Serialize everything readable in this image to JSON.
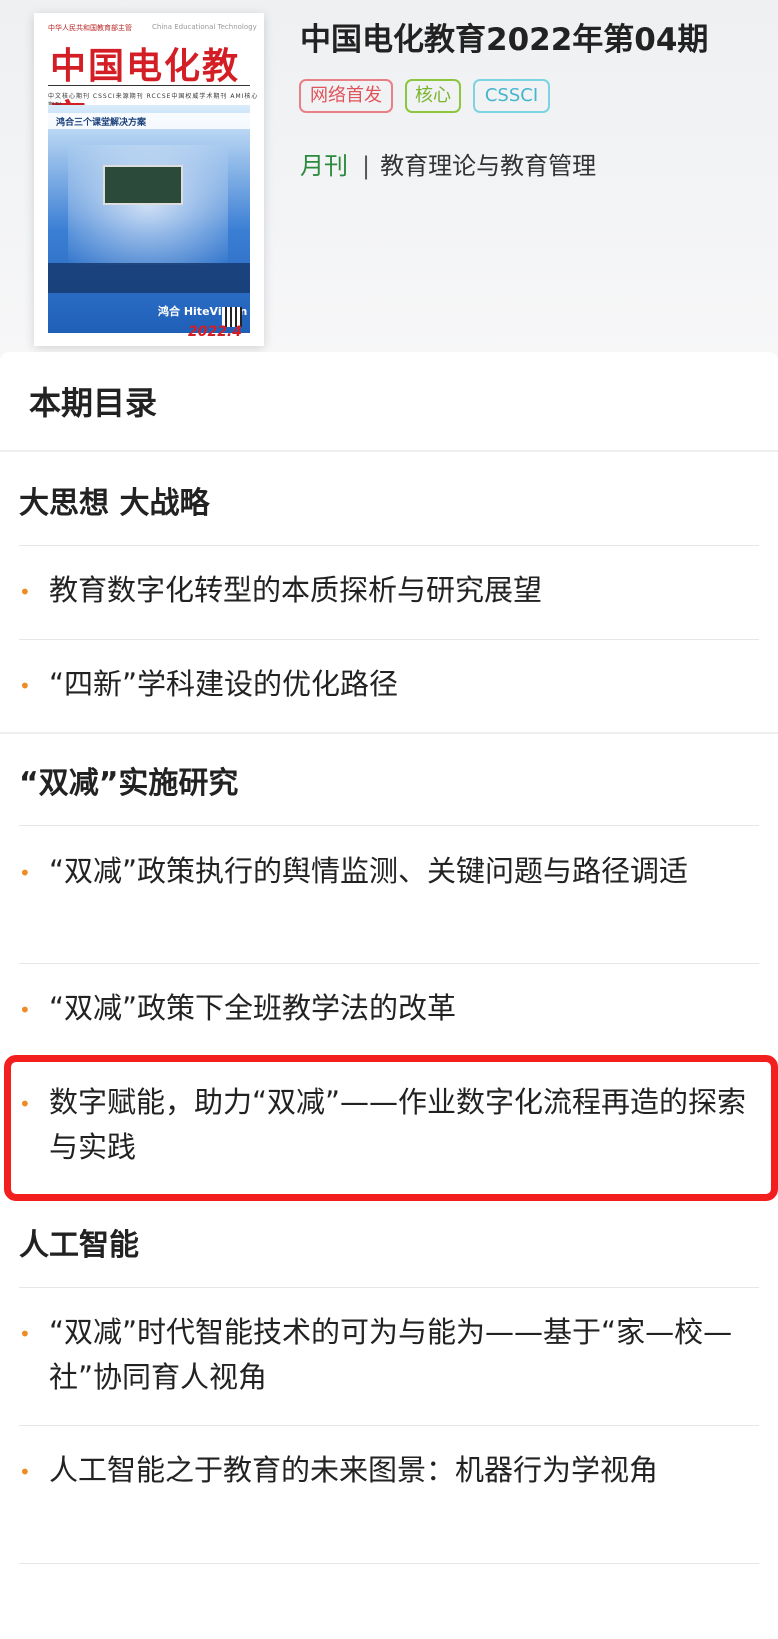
{
  "journal": {
    "title": "中国电化教育2022年第04期",
    "badges": [
      "网络首发",
      "核心",
      "CSSCI"
    ],
    "frequency": "月刊",
    "separator": "|",
    "subject": "教育理论与教育管理",
    "cover": {
      "logo": "中国电化教育",
      "sponsor_line": "中华人民共和国教育部主管",
      "english": "China Educational Technology",
      "tags": "中文核心期刊  CSSCI来源期刊  RCCSE中国权威学术期刊  AMI核心期刊",
      "feature": "鸿合三个课堂解决方案",
      "brand": "鸿合 HiteVision",
      "issue": "2022.4"
    },
    "colors": {
      "badge_network": "#e0555b",
      "badge_core": "#7bb52e",
      "badge_cssci": "#43b6cc",
      "frequency": "#2b8a3e",
      "bullet": "#f08a24",
      "highlight": "#f31e1e"
    }
  },
  "toc": {
    "heading": "本期目录",
    "sections": [
      {
        "title": "大思想 大战略",
        "articles": [
          "教育数字化转型的本质探析与研究展望",
          "“四新”学科建设的优化路径"
        ]
      },
      {
        "title": "“双减”实施研究",
        "articles": [
          "“双减”政策执行的舆情监测、关键问题与路径调适",
          "“双减”政策下全班教学法的改革",
          "数字赋能，助力“双减”——作业数字化流程再造的探索与实践"
        ]
      },
      {
        "title": "人工智能",
        "articles": [
          "“双减”时代智能技术的可为与能为——基于“家—校—社”协同育人视角",
          "人工智能之于教育的未来图景：机器行为学视角"
        ]
      }
    ],
    "bullet": "•",
    "highlighted_article": "数字赋能，助力“双减”——作业数字化流程再造的探索与实践"
  }
}
